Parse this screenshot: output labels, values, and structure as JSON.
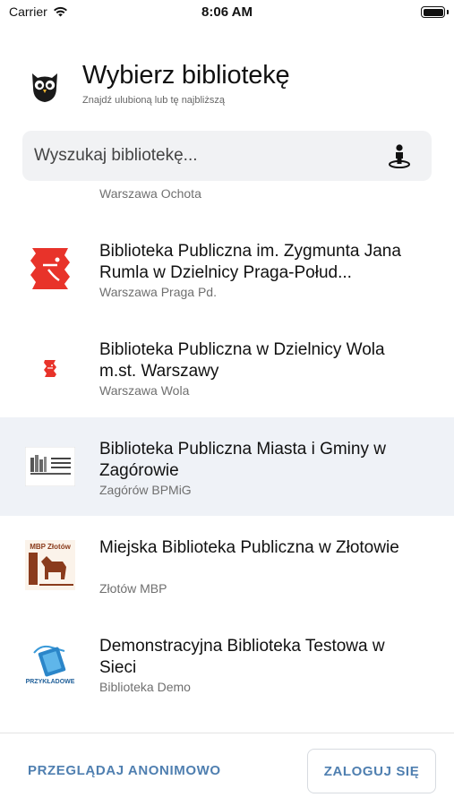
{
  "status_bar": {
    "carrier": "Carrier",
    "time": "8:06 AM",
    "wifi_icon": "wifi-icon",
    "battery_level": 1.0
  },
  "header": {
    "logo_icon": "owl-icon",
    "title": "Wybierz bibliotekę",
    "subtitle": "Znajdź ulubioną lub tę najbliższą"
  },
  "search": {
    "placeholder": "Wyszukaj bibliotekę...",
    "value": "",
    "locate_icon": "person-location-icon"
  },
  "libraries": [
    {
      "name": "",
      "subtitle": "Warszawa Ochota",
      "logo": "ochota-logo-icon"
    },
    {
      "name": "Biblioteka Publiczna im. Zygmunta Jana Rumla w Dzielnicy Praga-Połud...",
      "subtitle": "Warszawa Praga Pd.",
      "logo": "praga-red-logo-icon"
    },
    {
      "name": "Biblioteka Publiczna w Dzielnicy Wola m.st. Warszawy",
      "subtitle": "Warszawa Wola",
      "logo": "wola-red-logo-icon"
    },
    {
      "name": "Biblioteka Publiczna Miasta i Gminy w Zagórowie",
      "subtitle": "Zagórów BPMiG",
      "logo": "zagorow-logo-icon",
      "selected": true
    },
    {
      "name": "Miejska Biblioteka Publiczna w Złotowie",
      "subtitle": "Złotów MBP",
      "logo": "zlotow-logo-icon",
      "logo_text": "MBP Złotów"
    },
    {
      "name": "Demonstracyjna Biblioteka Testowa w Sieci",
      "subtitle": "Biblioteka Demo",
      "logo": "demo-book-logo-icon",
      "logo_text": "PRZYKŁADOWE"
    }
  ],
  "footer": {
    "anonymous_label": "PRZEGLĄDAJ ANONIMOWO",
    "login_label": "ZALOGUJ SIĘ"
  },
  "colors": {
    "accent": "#4f7fb0",
    "selected_row": "#eff2f7",
    "search_bg": "#f1f2f4",
    "logo_red": "#e8332a"
  }
}
